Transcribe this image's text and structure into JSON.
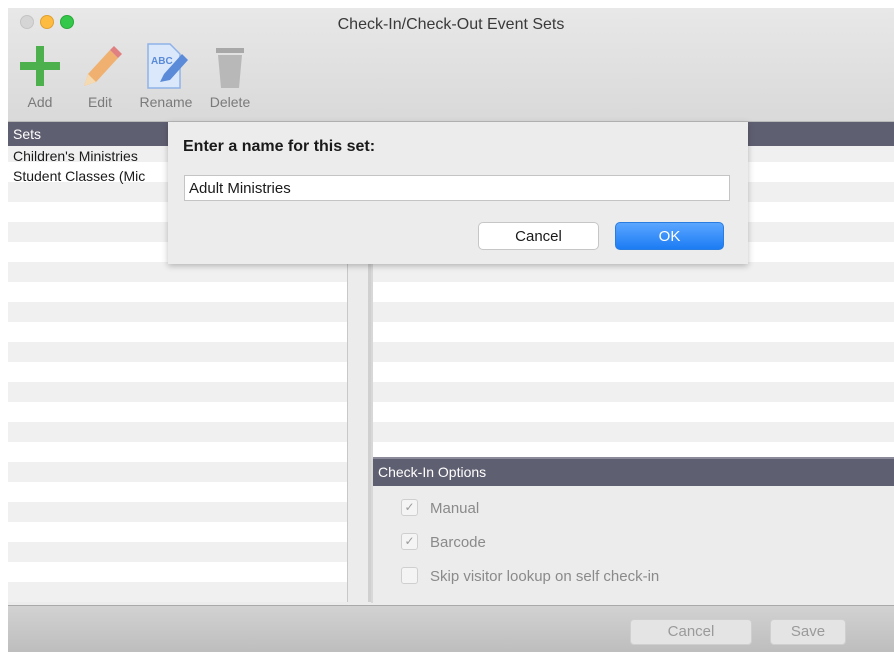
{
  "window": {
    "title": "Check-In/Check-Out Event Sets"
  },
  "toolbar": {
    "add": {
      "label": "Add",
      "icon": "plus-icon"
    },
    "edit": {
      "label": "Edit",
      "icon": "pencil-icon"
    },
    "rename": {
      "label": "Rename",
      "icon": "rename-document-icon"
    },
    "delete": {
      "label": "Delete",
      "icon": "trash-icon"
    }
  },
  "sets": {
    "header": "Sets",
    "items": [
      "Children's Ministries",
      "Student Classes (Mic"
    ]
  },
  "options": {
    "header": "Check-In Options",
    "manual": {
      "label": "Manual",
      "checked": true
    },
    "barcode": {
      "label": "Barcode",
      "checked": true
    },
    "skip_lookup": {
      "label": "Skip visitor lookup on self check-in",
      "checked": false
    }
  },
  "footer": {
    "cancel_label": "Cancel",
    "save_label": "Save"
  },
  "dialog": {
    "prompt": "Enter a name for this set:",
    "input_value": "Adult Ministries",
    "cancel_label": "Cancel",
    "ok_label": "OK"
  },
  "colors": {
    "header_bg": "#5f5f72",
    "accent_blue": "#1c7cf4",
    "add_green": "#4cb04c"
  }
}
